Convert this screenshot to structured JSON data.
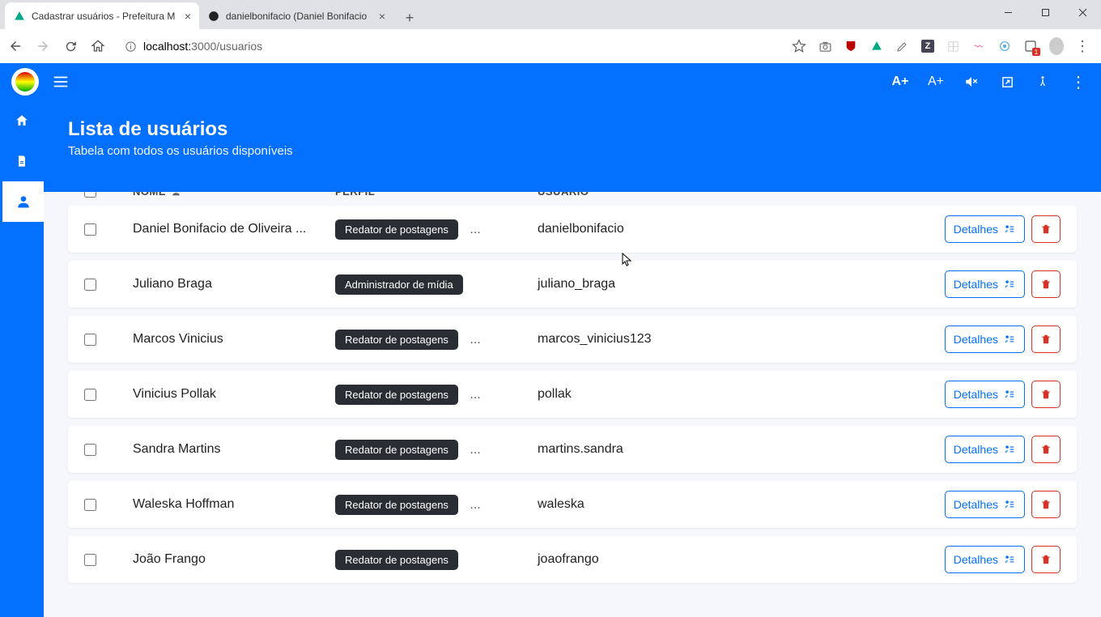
{
  "browser": {
    "tabs": [
      {
        "title": "Cadastrar usuários - Prefeitura M"
      },
      {
        "title": "danielbonifacio (Daniel Bonifacio"
      }
    ],
    "url_host": "localhost:",
    "url_port_path": "3000/usuarios"
  },
  "header": {
    "title": "Lista de usuários",
    "subtitle": "Tabela com todos os usuários disponíveis"
  },
  "topbar": {
    "a_plus_bold": "A+",
    "a_plus": "A+"
  },
  "table": {
    "columns": {
      "name": "NOME",
      "profile": "PERFIL",
      "user": "USUÁRIO"
    },
    "details_label": "Detalhes",
    "rows": [
      {
        "name": "Daniel Bonifacio de Oliveira ...",
        "profile": "Redator de postagens",
        "more": "...",
        "username": "danielbonifacio"
      },
      {
        "name": "Juliano Braga",
        "profile": "Administrador de mídia",
        "more": "",
        "username": "juliano_braga"
      },
      {
        "name": "Marcos Vinicius",
        "profile": "Redator de postagens",
        "more": "...",
        "username": "marcos_vinicius123"
      },
      {
        "name": "Vinicius Pollak",
        "profile": "Redator de postagens",
        "more": "...",
        "username": "pollak"
      },
      {
        "name": "Sandra Martins",
        "profile": "Redator de postagens",
        "more": "...",
        "username": "martins.sandra"
      },
      {
        "name": "Waleska Hoffman",
        "profile": "Redator de postagens",
        "more": "...",
        "username": "waleska"
      },
      {
        "name": "João Frango",
        "profile": "Redator de postagens",
        "more": "",
        "username": "joaofrango"
      }
    ]
  }
}
